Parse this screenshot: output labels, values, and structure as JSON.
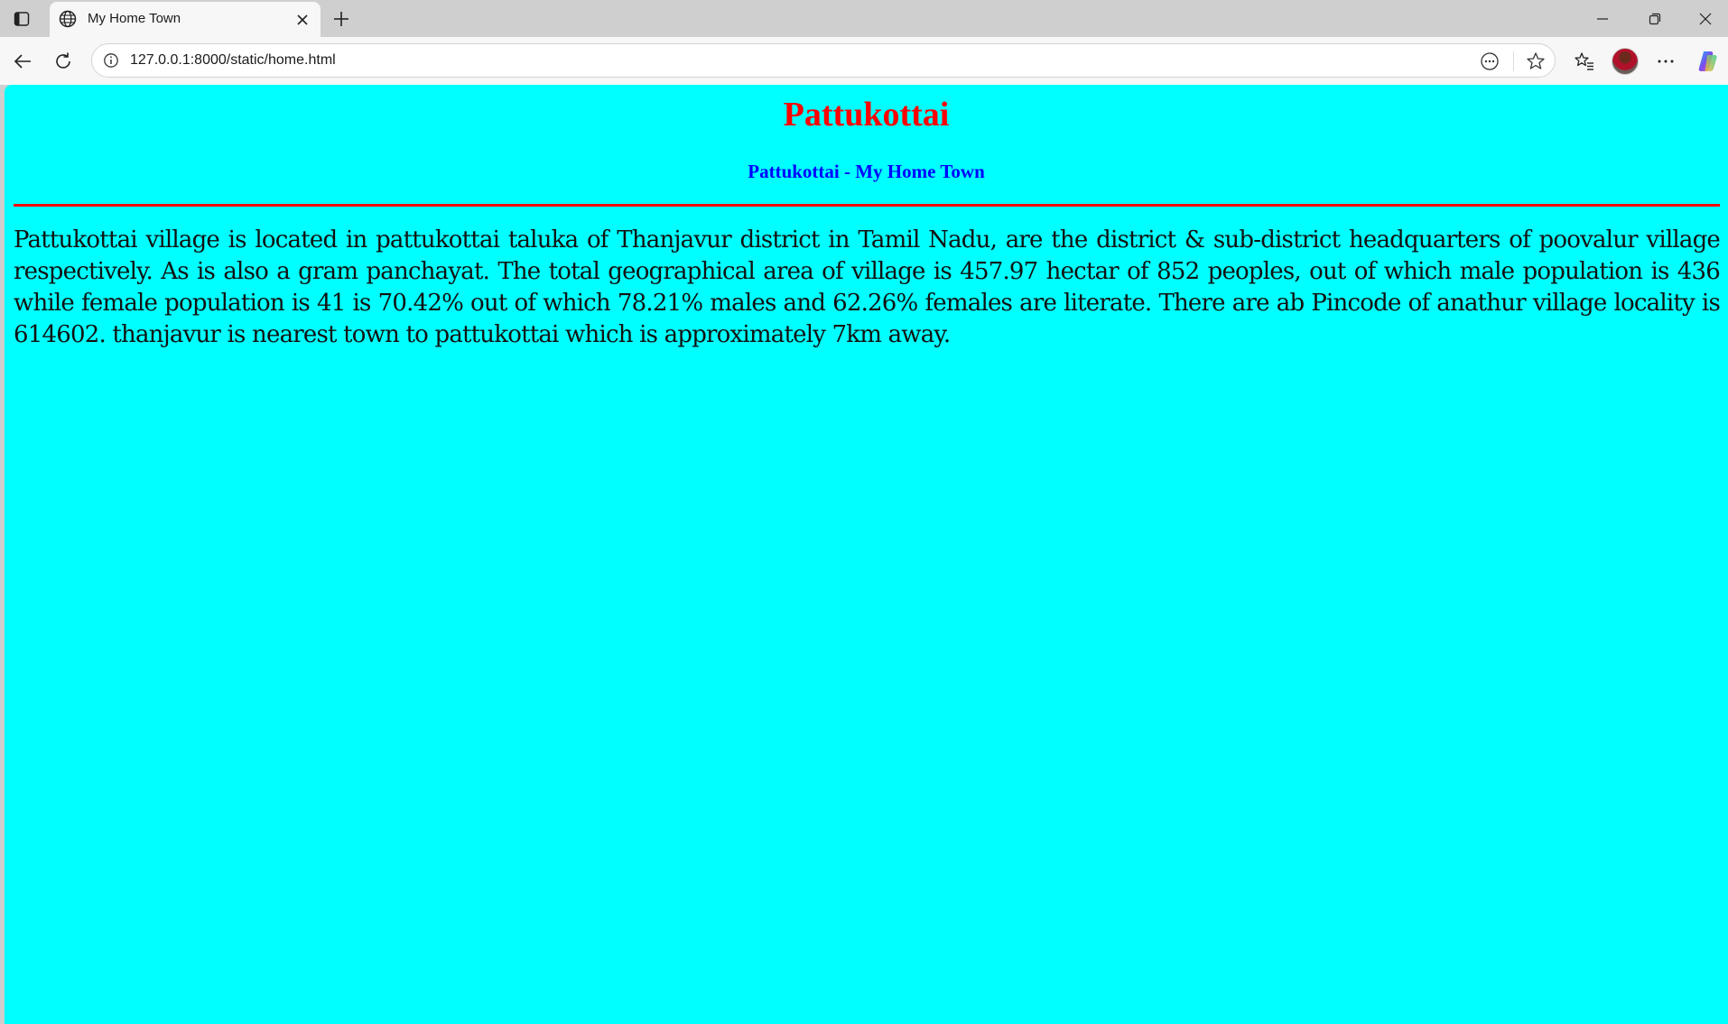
{
  "browser": {
    "tab": {
      "title": "My Home Town",
      "favicon": "globe-icon"
    },
    "address_bar": {
      "url": "127.0.0.1:8000/static/home.html"
    },
    "toolbar_icons": [
      "back-arrow-icon",
      "refresh-icon",
      "site-info-icon",
      "reading-mode-icon",
      "favorite-star-icon",
      "favorites-list-icon",
      "profile-avatar",
      "more-menu-icon",
      "copilot-icon"
    ],
    "window_controls": [
      "minimize-icon",
      "restore-icon",
      "close-icon"
    ]
  },
  "page": {
    "background_color": "#00ffff",
    "heading": "Pattukottai",
    "heading_color": "#ff0000",
    "subheading": "Pattukottai - My Home Town",
    "subheading_color": "#0000ff",
    "rule_color": "#ff0000",
    "paragraph": "Pattukottai village is located in pattukottai taluka of Thanjavur district in Tamil Nadu, are the district & sub-district headquarters of poovalur village respectively. As is also a gram panchayat. The total geographical area of village is 457.97 hectar of 852 peoples, out of which male population is 436 while female population is 41 is 70.42% out of which 78.21% males and 62.26% females are literate. There are ab Pincode of anathur village locality is 614602. thanjavur is nearest town to pattukottai which is approximately 7km away."
  }
}
